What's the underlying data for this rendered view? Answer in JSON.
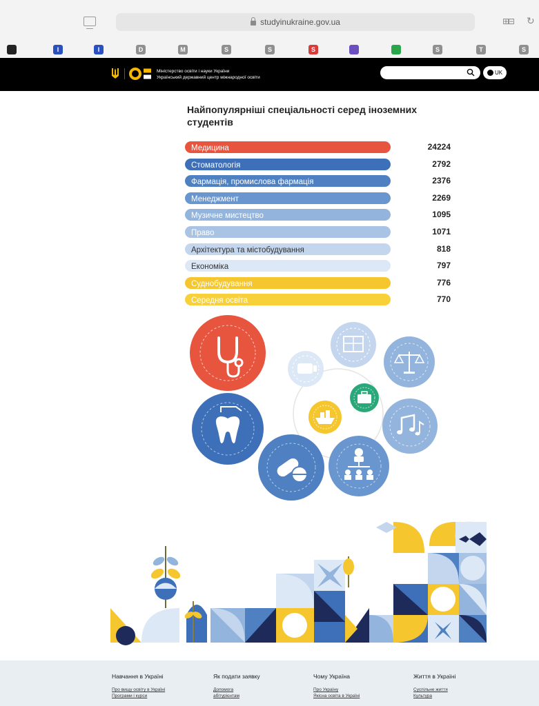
{
  "browser": {
    "url": "studyinukraine.gov.ua",
    "bookmarks": [
      {
        "letter": "",
        "color": "#222222"
      },
      {
        "letter": "I",
        "color": "#2a4fbf"
      },
      {
        "letter": "I",
        "color": "#2a4fbf"
      },
      {
        "letter": "D",
        "color": "#8f8f8f"
      },
      {
        "letter": "M",
        "color": "#8f8f8f"
      },
      {
        "letter": "S",
        "color": "#8f8f8f"
      },
      {
        "letter": "S",
        "color": "#8f8f8f"
      },
      {
        "letter": "S",
        "color": "#d93a3a"
      },
      {
        "letter": "",
        "color": "#6c4fbf"
      },
      {
        "letter": "",
        "color": "#2aa64a"
      },
      {
        "letter": "S",
        "color": "#8f8f8f"
      },
      {
        "letter": "T",
        "color": "#8f8f8f"
      },
      {
        "letter": "S",
        "color": "#8f8f8f"
      }
    ]
  },
  "header": {
    "brand_line1": "Міністерство освіти і науки України",
    "brand_line2": "Український державний центр міжнародної освіти",
    "lang_label": "UK",
    "colors": {
      "background": "#000000",
      "logo_yellow": "#f5b700"
    }
  },
  "main": {
    "title": "Найпопулярніші спеціальності серед іноземних студентів",
    "stats": [
      {
        "label": "Медицина",
        "value": "24224",
        "color": "#e8553f",
        "text_color": "#ffffff"
      },
      {
        "label": "Стоматологія",
        "value": "2792",
        "color": "#3d70b8",
        "text_color": "#ffffff"
      },
      {
        "label": "Фармація, промислова фармація",
        "value": "2376",
        "color": "#4f80c2",
        "text_color": "#ffffff"
      },
      {
        "label": "Менеджмент",
        "value": "2269",
        "color": "#6a96cf",
        "text_color": "#ffffff"
      },
      {
        "label": "Музичне мистецтво",
        "value": "1095",
        "color": "#93b4dc",
        "text_color": "#ffffff"
      },
      {
        "label": "Право",
        "value": "1071",
        "color": "#a9c3e4",
        "text_color": "#ffffff"
      },
      {
        "label": "Архітектура та містобудування",
        "value": "818",
        "color": "#c3d6ee",
        "text_color": "#333333"
      },
      {
        "label": "Економіка",
        "value": "797",
        "color": "#dde8f6",
        "text_color": "#333333"
      },
      {
        "label": "Суднобудування",
        "value": "776",
        "color": "#f5c62d",
        "text_color": "#ffffff"
      },
      {
        "label": "Середня освіта",
        "value": "770",
        "color": "#f8d13a",
        "text_color": "#ffffff"
      }
    ]
  },
  "illustration": {
    "icons": [
      "stethoscope-icon",
      "tooth-icon",
      "pills-icon",
      "org-chart-icon",
      "music-notes-icon",
      "scales-icon",
      "blueprint-icon",
      "tv-icon",
      "briefcase-icon",
      "ship-icon"
    ]
  },
  "footer": {
    "columns": [
      {
        "heading": "Навчання в Україні",
        "links": [
          "Про вищу освіту в Україні",
          "Програми і курси"
        ]
      },
      {
        "heading": "Як подати заявку",
        "links": [
          "Допомога",
          "абітурієнтам"
        ]
      },
      {
        "heading": "Чому Україна",
        "links": [
          "Про Україну",
          "Якісна освіта в Україні"
        ]
      },
      {
        "heading": "Життя в Україні",
        "links": [
          "Суспільне життя",
          "Культура"
        ]
      }
    ]
  }
}
